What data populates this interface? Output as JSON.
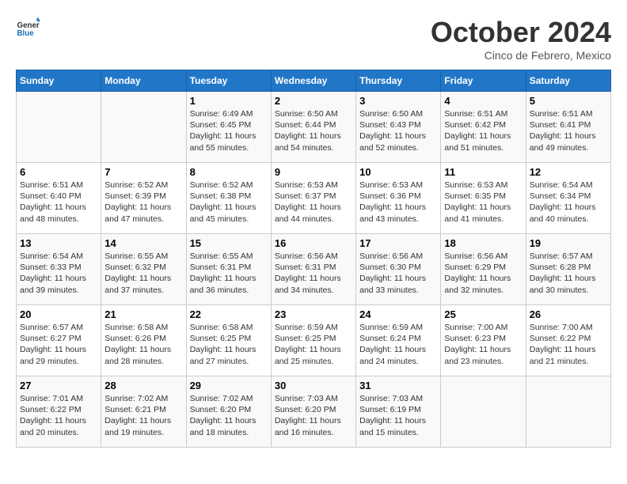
{
  "header": {
    "logo_general": "General",
    "logo_blue": "Blue",
    "month": "October 2024",
    "location": "Cinco de Febrero, Mexico"
  },
  "weekdays": [
    "Sunday",
    "Monday",
    "Tuesday",
    "Wednesday",
    "Thursday",
    "Friday",
    "Saturday"
  ],
  "weeks": [
    [
      null,
      null,
      {
        "day": 1,
        "sunrise": "6:49 AM",
        "sunset": "6:45 PM",
        "daylight": "11 hours and 55 minutes."
      },
      {
        "day": 2,
        "sunrise": "6:50 AM",
        "sunset": "6:44 PM",
        "daylight": "11 hours and 54 minutes."
      },
      {
        "day": 3,
        "sunrise": "6:50 AM",
        "sunset": "6:43 PM",
        "daylight": "11 hours and 52 minutes."
      },
      {
        "day": 4,
        "sunrise": "6:51 AM",
        "sunset": "6:42 PM",
        "daylight": "11 hours and 51 minutes."
      },
      {
        "day": 5,
        "sunrise": "6:51 AM",
        "sunset": "6:41 PM",
        "daylight": "11 hours and 49 minutes."
      }
    ],
    [
      {
        "day": 6,
        "sunrise": "6:51 AM",
        "sunset": "6:40 PM",
        "daylight": "11 hours and 48 minutes."
      },
      {
        "day": 7,
        "sunrise": "6:52 AM",
        "sunset": "6:39 PM",
        "daylight": "11 hours and 47 minutes."
      },
      {
        "day": 8,
        "sunrise": "6:52 AM",
        "sunset": "6:38 PM",
        "daylight": "11 hours and 45 minutes."
      },
      {
        "day": 9,
        "sunrise": "6:53 AM",
        "sunset": "6:37 PM",
        "daylight": "11 hours and 44 minutes."
      },
      {
        "day": 10,
        "sunrise": "6:53 AM",
        "sunset": "6:36 PM",
        "daylight": "11 hours and 43 minutes."
      },
      {
        "day": 11,
        "sunrise": "6:53 AM",
        "sunset": "6:35 PM",
        "daylight": "11 hours and 41 minutes."
      },
      {
        "day": 12,
        "sunrise": "6:54 AM",
        "sunset": "6:34 PM",
        "daylight": "11 hours and 40 minutes."
      }
    ],
    [
      {
        "day": 13,
        "sunrise": "6:54 AM",
        "sunset": "6:33 PM",
        "daylight": "11 hours and 39 minutes."
      },
      {
        "day": 14,
        "sunrise": "6:55 AM",
        "sunset": "6:32 PM",
        "daylight": "11 hours and 37 minutes."
      },
      {
        "day": 15,
        "sunrise": "6:55 AM",
        "sunset": "6:31 PM",
        "daylight": "11 hours and 36 minutes."
      },
      {
        "day": 16,
        "sunrise": "6:56 AM",
        "sunset": "6:31 PM",
        "daylight": "11 hours and 34 minutes."
      },
      {
        "day": 17,
        "sunrise": "6:56 AM",
        "sunset": "6:30 PM",
        "daylight": "11 hours and 33 minutes."
      },
      {
        "day": 18,
        "sunrise": "6:56 AM",
        "sunset": "6:29 PM",
        "daylight": "11 hours and 32 minutes."
      },
      {
        "day": 19,
        "sunrise": "6:57 AM",
        "sunset": "6:28 PM",
        "daylight": "11 hours and 30 minutes."
      }
    ],
    [
      {
        "day": 20,
        "sunrise": "6:57 AM",
        "sunset": "6:27 PM",
        "daylight": "11 hours and 29 minutes."
      },
      {
        "day": 21,
        "sunrise": "6:58 AM",
        "sunset": "6:26 PM",
        "daylight": "11 hours and 28 minutes."
      },
      {
        "day": 22,
        "sunrise": "6:58 AM",
        "sunset": "6:25 PM",
        "daylight": "11 hours and 27 minutes."
      },
      {
        "day": 23,
        "sunrise": "6:59 AM",
        "sunset": "6:25 PM",
        "daylight": "11 hours and 25 minutes."
      },
      {
        "day": 24,
        "sunrise": "6:59 AM",
        "sunset": "6:24 PM",
        "daylight": "11 hours and 24 minutes."
      },
      {
        "day": 25,
        "sunrise": "7:00 AM",
        "sunset": "6:23 PM",
        "daylight": "11 hours and 23 minutes."
      },
      {
        "day": 26,
        "sunrise": "7:00 AM",
        "sunset": "6:22 PM",
        "daylight": "11 hours and 21 minutes."
      }
    ],
    [
      {
        "day": 27,
        "sunrise": "7:01 AM",
        "sunset": "6:22 PM",
        "daylight": "11 hours and 20 minutes."
      },
      {
        "day": 28,
        "sunrise": "7:02 AM",
        "sunset": "6:21 PM",
        "daylight": "11 hours and 19 minutes."
      },
      {
        "day": 29,
        "sunrise": "7:02 AM",
        "sunset": "6:20 PM",
        "daylight": "11 hours and 18 minutes."
      },
      {
        "day": 30,
        "sunrise": "7:03 AM",
        "sunset": "6:20 PM",
        "daylight": "11 hours and 16 minutes."
      },
      {
        "day": 31,
        "sunrise": "7:03 AM",
        "sunset": "6:19 PM",
        "daylight": "11 hours and 15 minutes."
      },
      null,
      null
    ]
  ]
}
